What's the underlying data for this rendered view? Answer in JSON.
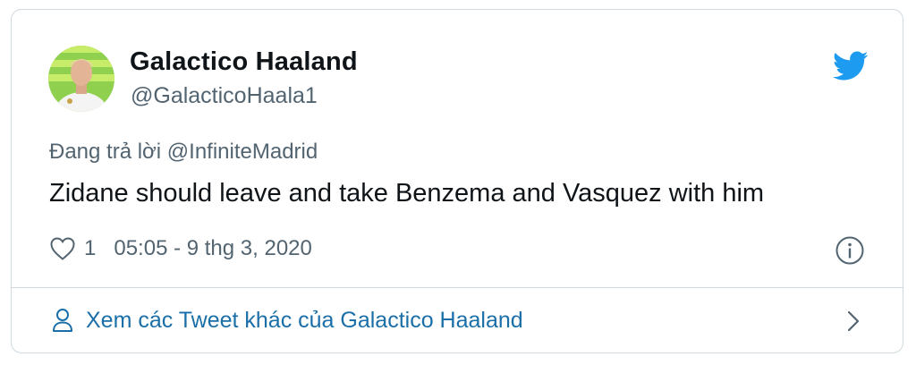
{
  "author": {
    "display_name": "Galactico Haaland",
    "handle": "@GalacticoHaala1"
  },
  "tweet": {
    "reply_to": "Đang trả lời @InfiniteMadrid",
    "text": "Zidane should leave and take Benzema and Vasquez with him",
    "like_count": "1",
    "timestamp": "05:05 - 9 thg 3, 2020"
  },
  "footer": {
    "more_tweets_label": "Xem các Tweet khác của Galactico Haaland"
  },
  "icons": {
    "brand": "twitter-bird-icon",
    "like": "heart-icon",
    "info": "info-icon",
    "user": "user-icon",
    "chevron": "chevron-right-icon"
  },
  "colors": {
    "brand_blue": "#1d9bf0",
    "link_blue": "#1b6fa8",
    "text_primary": "#0f1419",
    "text_secondary": "#536471",
    "border": "#cfd9de"
  }
}
